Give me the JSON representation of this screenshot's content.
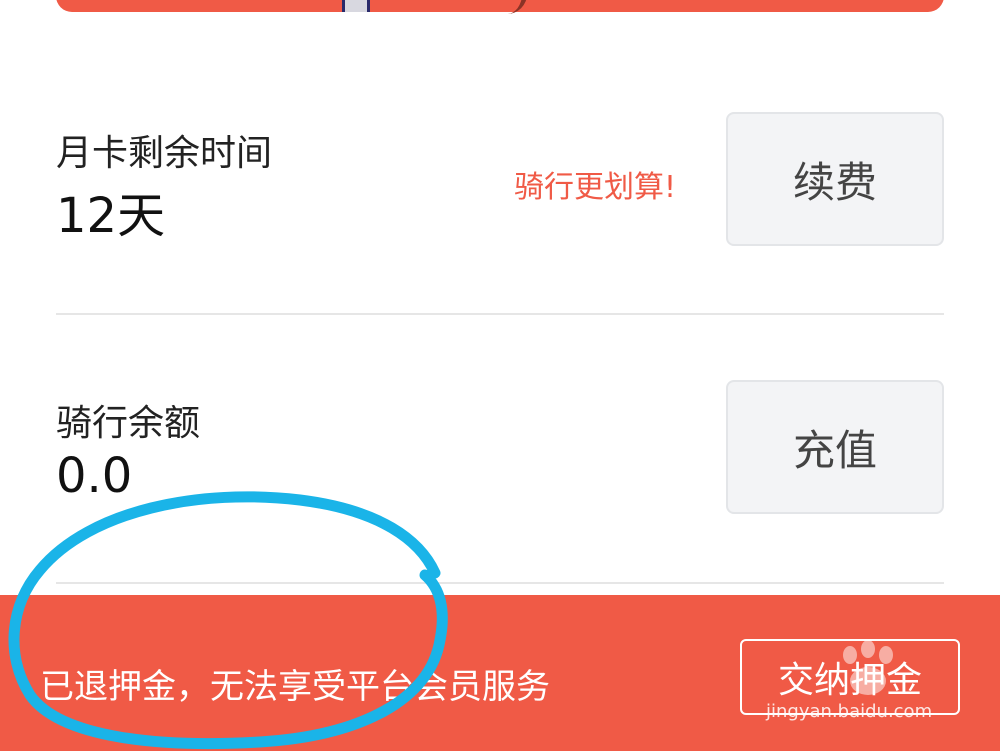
{
  "monthly_card": {
    "label": "月卡剩余时间",
    "value": "12天",
    "promo": "骑行更划算!",
    "button": "续费"
  },
  "ride_balance": {
    "label": "骑行余额",
    "value": "0.0",
    "button": "充值"
  },
  "bottom_bar": {
    "message": "已退押金，无法享受平台会员服务",
    "button": "交纳押金"
  },
  "watermark": "jingyan.baidu.com",
  "colors": {
    "accent": "#f05a46",
    "button_bg": "#f3f4f6",
    "annotation": "#1ab4e8"
  }
}
